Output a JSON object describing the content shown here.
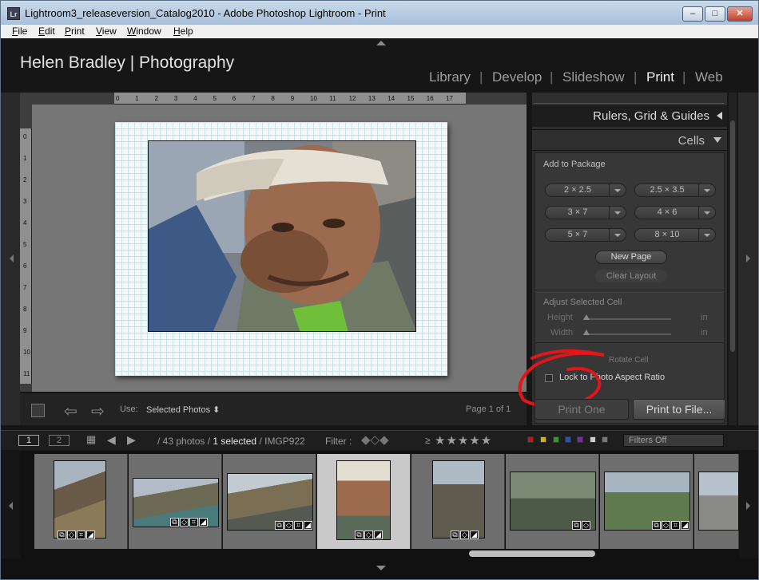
{
  "window": {
    "title": "Lightroom3_releaseversion_Catalog2010 - Adobe Photoshop Lightroom - Print",
    "app_icon": "Lr",
    "controls": {
      "minimize": "–",
      "maximize": "□",
      "close": "✕"
    }
  },
  "menu": [
    "File",
    "Edit",
    "Print",
    "View",
    "Window",
    "Help"
  ],
  "identity_plate": "Helen Bradley | Photography",
  "modules": [
    "Library",
    "Develop",
    "Slideshow",
    "Print",
    "Web"
  ],
  "active_module": "Print",
  "ruler": {
    "top_ticks": [
      "0",
      "1",
      "2",
      "3",
      "4",
      "5",
      "6",
      "7",
      "8",
      "9",
      "10",
      "11",
      "12",
      "13",
      "14",
      "15",
      "16",
      "17"
    ],
    "left_ticks": [
      "0",
      "1",
      "2",
      "3",
      "4",
      "5",
      "6",
      "7",
      "8",
      "9",
      "10",
      "11"
    ]
  },
  "toolbar": {
    "use_label": "Use:",
    "use_value": "Selected Photos ⬍",
    "page_count": "Page 1 of 1"
  },
  "right_panel": {
    "rulers_header": "Rulers, Grid & Guides",
    "cells_header": "Cells",
    "add_to_package": "Add to Package",
    "sizes": [
      "2 × 2.5",
      "2.5 × 3.5",
      "3 × 7",
      "4 × 6",
      "5 × 7",
      "8 × 10"
    ],
    "new_page": "New Page",
    "clear_layout": "Clear Layout",
    "adjust_title": "Adjust Selected Cell",
    "height_label": "Height",
    "width_label": "Width",
    "unit": "in",
    "rotate_cell": "Rotate Cell",
    "lock_label": "Lock to Photo Aspect Ratio"
  },
  "buttons": {
    "print_one": "Print One",
    "print_file": "Print to File..."
  },
  "filmstrip_bar": {
    "monitor1": "1",
    "monitor2": "2",
    "count_text": "/ 43 photos /",
    "selected_text": "1 selected",
    "filename": "/ IMGP922",
    "filter_label": "Filter :",
    "rating_prefix": "≥",
    "stars": "★★★★★",
    "filters_off": "Filters Off",
    "color_labels": [
      "#b21e1e",
      "#c9b41f",
      "#2f9a2f",
      "#2d4fb5",
      "#7a2da0",
      "#cccccc",
      "#777777"
    ]
  },
  "filmstrip": {
    "selected_index": 3,
    "count_visible": 8
  }
}
